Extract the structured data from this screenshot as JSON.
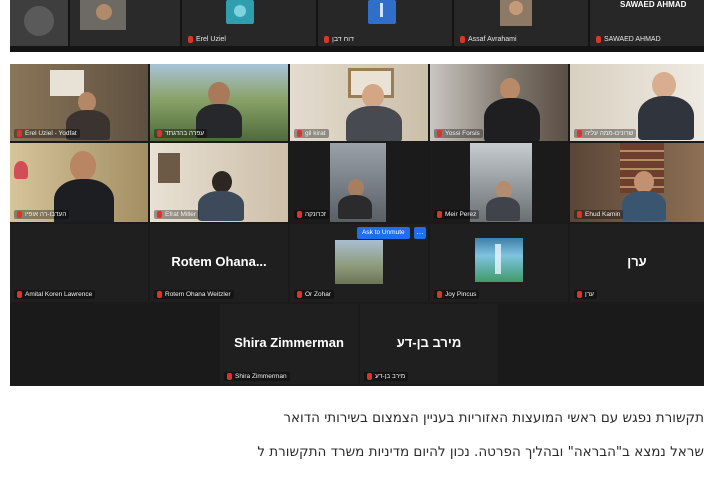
{
  "top_strip": {
    "tiles": [
      {
        "name": "",
        "bg": "#4a4a4a"
      },
      {
        "name": "Erel Uziel",
        "bg": "#2b2b2b"
      },
      {
        "name": "דוח דבן",
        "bg": "#2b2b2b"
      },
      {
        "name": "Assaf Avrahami",
        "bg": "#2b2b2b"
      },
      {
        "name": "SAWAED AHMAD",
        "bg": "#2b2b2b"
      }
    ],
    "banner_text": "SAWAED AHMAD"
  },
  "gallery": {
    "row1": [
      {
        "name": "Erel Uziel - Yodfat",
        "bg": "#6b5b45"
      },
      {
        "name": "עפרה בהדגתד",
        "bg": "#6e8a55"
      },
      {
        "name": "gil kirat",
        "bg": "#c9b8a0"
      },
      {
        "name": "Yossi Forsis",
        "bg": "#8e8a86"
      },
      {
        "name": "שרונים-ממה עליה",
        "bg": "#cfc8bb"
      }
    ],
    "row2": [
      {
        "name": "העדבו-רה אופיו",
        "bg": "#b9a57d"
      },
      {
        "name": "Efrat Miller",
        "bg": "#d7cfc3"
      },
      {
        "name": "זכרונקה",
        "bg": "#7f8186"
      },
      {
        "name": "Meir Perez",
        "bg": "#8a8e92"
      },
      {
        "name": "Ehud Kamin",
        "bg": "#5d4b3c"
      }
    ],
    "row3": [
      {
        "name": "Amital Koren Lawrence",
        "big": ""
      },
      {
        "name": "Rotem Ohana Weitzler",
        "big": "Rotem  Ohana..."
      },
      {
        "name": "Or Zohar",
        "big": ""
      },
      {
        "name": "Joy Pincus",
        "big": ""
      },
      {
        "name": "ערן",
        "big": "ערן"
      }
    ],
    "row4": [
      {
        "name": "Shira Zimmerman",
        "big": "Shira Zimmerman"
      },
      {
        "name": "מירב בן-דע",
        "big": "מירב בן-דע"
      }
    ],
    "unmute_label": "Ask to Unmute",
    "more_label": "…"
  },
  "article": {
    "line1": "תקשורת נפגש עם ראשי המועצות האזוריות בעניין הצמצום בשירותי הדואר",
    "line2": "שראל נמצא ב\"הבראה\" ובהליך הפרטה. נכון להיום מדיניות משרד התקשורת ל"
  }
}
